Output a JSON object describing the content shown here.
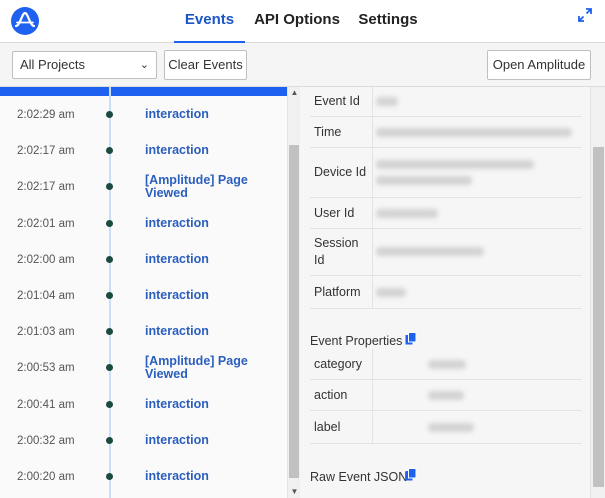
{
  "header": {
    "tabs": [
      {
        "label": "Events",
        "active": true
      },
      {
        "label": "API Options",
        "active": false
      },
      {
        "label": "Settings",
        "active": false
      }
    ],
    "icons": {
      "logo": "amplitude-logo",
      "expand": "expand-icon"
    },
    "accent_color": "#1e61f0"
  },
  "toolbar": {
    "project_select": {
      "value": "All Projects",
      "icon": "chevron-down-icon"
    },
    "clear_label": "Clear Events",
    "open_label": "Open Amplitude"
  },
  "events": [
    {
      "time": "2:02:29 am",
      "name": "interaction"
    },
    {
      "time": "2:02:17 am",
      "name": "interaction"
    },
    {
      "time": "2:02:17 am",
      "name": "[Amplitude] Page Viewed"
    },
    {
      "time": "2:02:01 am",
      "name": "interaction"
    },
    {
      "time": "2:02:00 am",
      "name": "interaction"
    },
    {
      "time": "2:01:04 am",
      "name": "interaction"
    },
    {
      "time": "2:01:03 am",
      "name": "interaction"
    },
    {
      "time": "2:00:53 am",
      "name": "[Amplitude] Page Viewed"
    },
    {
      "time": "2:00:41 am",
      "name": "interaction"
    },
    {
      "time": "2:00:32 am",
      "name": "interaction"
    },
    {
      "time": "2:00:20 am",
      "name": "interaction"
    }
  ],
  "details": {
    "fields": [
      {
        "key": "Event Id"
      },
      {
        "key": "Time"
      },
      {
        "key": "Device Id"
      },
      {
        "key": "User Id"
      },
      {
        "key": "Session Id"
      },
      {
        "key": "Platform"
      }
    ],
    "event_properties_title": "Event Properties",
    "event_properties": [
      {
        "key": "category"
      },
      {
        "key": "action"
      },
      {
        "key": "label"
      }
    ],
    "raw_json_title": "Raw Event JSON",
    "copy_icon": "copy-icon"
  }
}
